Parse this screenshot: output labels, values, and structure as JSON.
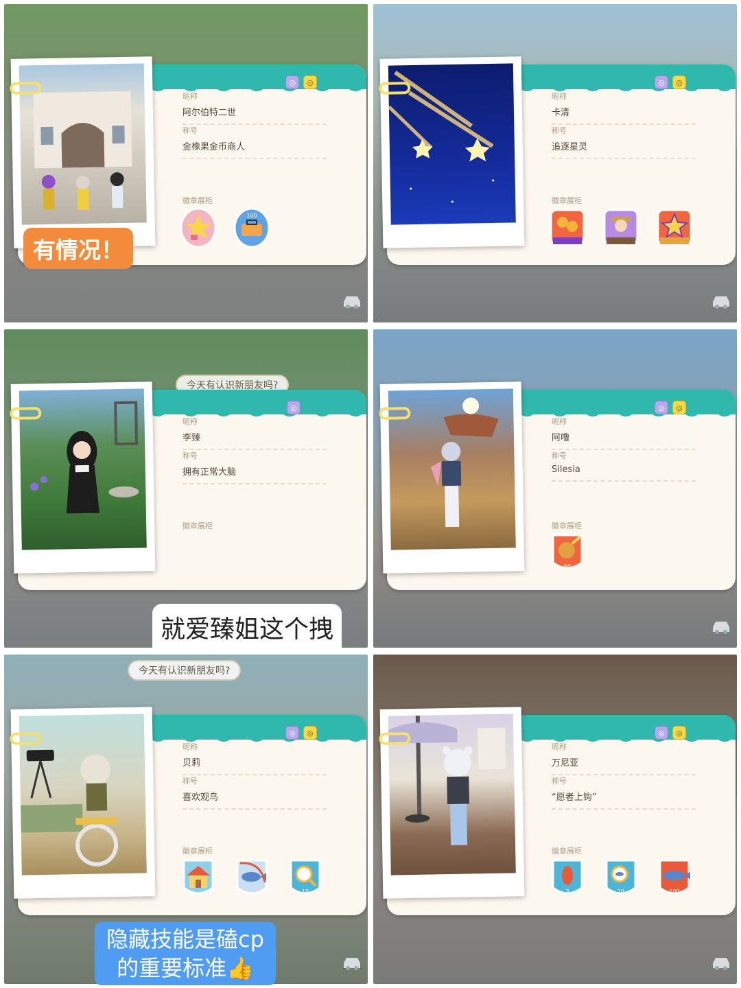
{
  "panels": [
    {
      "nickname_label": "昵称",
      "nickname": "阿尔伯特二世",
      "title_label": "称号",
      "title": "金橡果金币商人",
      "badges_label": "徽章展柜",
      "chips": [
        "purple",
        "yellow"
      ],
      "badges": [
        "star-heart-badge-icon",
        "toolbox-100-badge-icon"
      ],
      "photo": "house-trio"
    },
    {
      "nickname_label": "昵称",
      "nickname": "卡清",
      "title_label": "称号",
      "title": "追逐星灵",
      "badges_label": "徽章展柜",
      "chips": [
        "purple",
        "yellow"
      ],
      "badges": [
        "coins-badge-icon",
        "farmer-badge-icon",
        "star-badge-icon"
      ],
      "photo": "shooting-stars"
    },
    {
      "nickname_label": "昵称",
      "nickname": "李臻",
      "title_label": "称号",
      "title": "拥有正常大脑",
      "badges_label": "徽章展柜",
      "chips": [
        "purple"
      ],
      "badges": [],
      "photo": "garden-girl",
      "speech": "今天有认识新朋友吗?"
    },
    {
      "nickname_label": "昵称",
      "nickname": "阿噜",
      "title_label": "称号",
      "title": "Silesia",
      "badges_label": "徽章展柜",
      "chips": [
        "purple",
        "yellow"
      ],
      "badges": [
        "meteor-60-badge-icon"
      ],
      "photo": "canyon-boy"
    },
    {
      "nickname_label": "昵称",
      "nickname": "贝莉",
      "title_label": "称号",
      "title": "喜欢观鸟",
      "badges_label": "徽章展柜",
      "chips": [
        "purple",
        "yellow"
      ],
      "badges": [
        "house-badge-icon",
        "fish-badge-icon",
        "bird-10-badge-icon"
      ],
      "photo": "camera-room",
      "speech": "今天有认识新朋友吗?"
    },
    {
      "nickname_label": "昵称",
      "nickname": "万尼亚",
      "title_label": "称号",
      "title": "“愿者上钩”",
      "badges_label": "徽章展柜",
      "chips": [
        "purple",
        "yellow"
      ],
      "badges": [
        "fish-3-badge-icon",
        "fish-10-badge-icon",
        "fish-100-badge-icon"
      ],
      "photo": "porch-bear-hat"
    }
  ],
  "captions": {
    "top_left": "有情况！",
    "middle_left": "就爱臻姐这个拽",
    "bottom_left": "隐藏技能是磕cp的重要标准👍"
  },
  "badge_numbers": {
    "toolbox": "100",
    "meteor": "60",
    "bird": "10",
    "fish3": "3",
    "fish10": "10",
    "fish100": "100"
  },
  "colors": {
    "band": "#2fb9ad",
    "card": "#fcf7ef",
    "caption_orange": "#f48b3a",
    "caption_blue": "#4f9cf2"
  }
}
